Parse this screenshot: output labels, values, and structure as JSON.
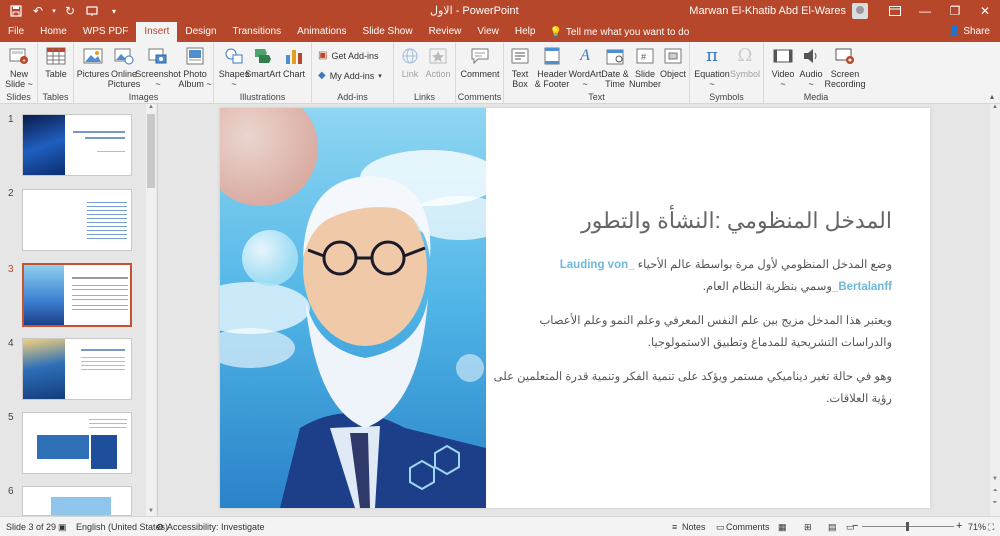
{
  "app": {
    "title": "الاول  -  PowerPoint",
    "user_name": "Marwan El-Khatib Abd El-Wares",
    "share_label": "Share"
  },
  "quick_access": [
    "save-icon",
    "undo-icon",
    "redo-icon",
    "present-icon"
  ],
  "tabs": [
    "File",
    "Home",
    "WPS PDF",
    "Insert",
    "Design",
    "Transitions",
    "Animations",
    "Slide Show",
    "Review",
    "View",
    "Help"
  ],
  "tell_me": "Tell me what you want to do",
  "ribbon": {
    "slides": {
      "new_slide": "New\nSlide ~",
      "label": "Slides"
    },
    "tables": {
      "table": "Table",
      "label": "Tables"
    },
    "images": {
      "pictures": "Pictures",
      "online_pictures": "Online\nPictures",
      "screenshot": "Screenshot\n~",
      "photo_album": "Photo\nAlbum ~",
      "label": "Images"
    },
    "illustrations": {
      "shapes": "Shapes\n~",
      "smartart": "SmartArt",
      "chart": "Chart",
      "label": "Illustrations"
    },
    "addins": {
      "get": "Get Add-ins",
      "my": "My Add-ins",
      "label": "Add-ins"
    },
    "links": {
      "link": "Link",
      "action": "Action",
      "label": "Links"
    },
    "comments": {
      "comment": "Comment",
      "label": "Comments"
    },
    "text": {
      "text_box": "Text\nBox",
      "header_footer": "Header\n& Footer",
      "wordart": "WordArt\n~",
      "date_time": "Date &\nTime",
      "slide_number": "Slide\nNumber",
      "object": "Object",
      "label": "Text"
    },
    "symbols": {
      "equation": "Equation\n~",
      "symbol": "Symbol",
      "label": "Symbols"
    },
    "media": {
      "video": "Video\n~",
      "audio": "Audio\n~",
      "screen_recording": "Screen\nRecording",
      "label": "Media"
    }
  },
  "thumbnails": [
    "1",
    "2",
    "3",
    "4",
    "5",
    "6"
  ],
  "slide": {
    "title": "المدخل المنظومي :النشأة والتطور",
    "p1_part1": "وضع المدخل المنظومي لأول مرة بواسطة عالم الأحياء",
    "p1_hl1": "Lauding von_",
    "p1_hl2": "Bertalanff_",
    "p1_part2": "وسمي بنظرية النظام العام.",
    "p2": "ويعتبر هذا المدخل مزيج بين علم النفس المعرفي وعلم النمو وعلم الأعصاب والدراسات التشريحية للمدماغ وتطبيق الاستمولوجيا.",
    "p3": "وهو في حالة تغير ديناميكي مستمر ويؤكد على تنمية الفكر وتنمية قدرة المتعلمين على رؤية العلاقات."
  },
  "status": {
    "slide_counter": "Slide 3 of 29",
    "language": "English (United States)",
    "accessibility": "Accessibility: Investigate",
    "notes": "Notes",
    "comments": "Comments",
    "zoom": "71%"
  }
}
